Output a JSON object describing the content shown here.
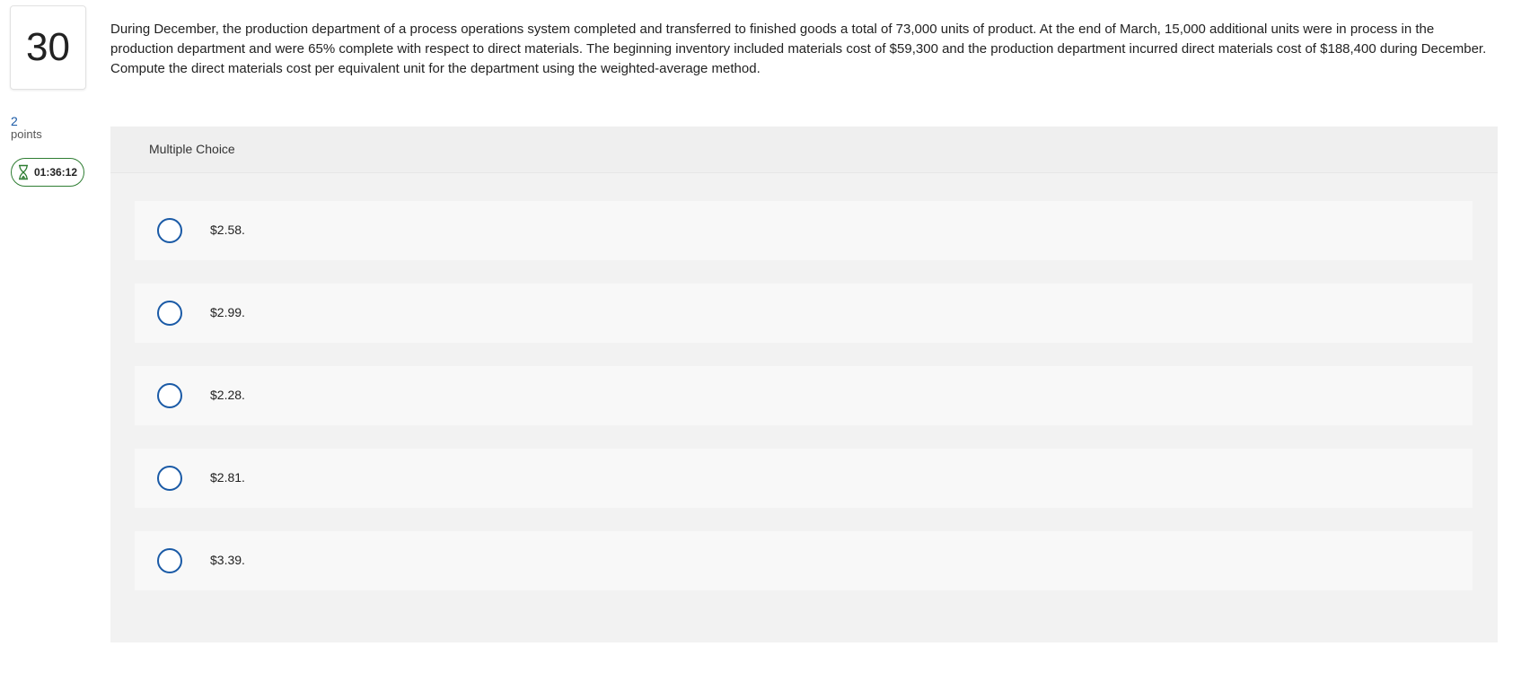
{
  "question": {
    "number": "30",
    "points_value": "2",
    "points_label": "points",
    "timer": "01:36:12",
    "timer_icon": "hourglass-icon",
    "text": "During December, the production department of a process operations system completed and transferred to finished goods a total of 73,000 units of product. At the end of March, 15,000 additional units were in process in the production department and were 65% complete with respect to direct materials. The beginning inventory included materials cost of $59,300 and the production department incurred direct materials cost of $188,400 during December. Compute the direct materials cost per equivalent unit for the department using the weighted-average method."
  },
  "choice_panel": {
    "title": "Multiple Choice",
    "options": [
      {
        "label": "$2.58."
      },
      {
        "label": "$2.99."
      },
      {
        "label": "$2.28."
      },
      {
        "label": "$2.81."
      },
      {
        "label": "$3.39."
      }
    ]
  },
  "colors": {
    "accent_blue": "#1a5aa6",
    "timer_green": "#2e7d32",
    "panel_gray": "#eeeeee"
  }
}
